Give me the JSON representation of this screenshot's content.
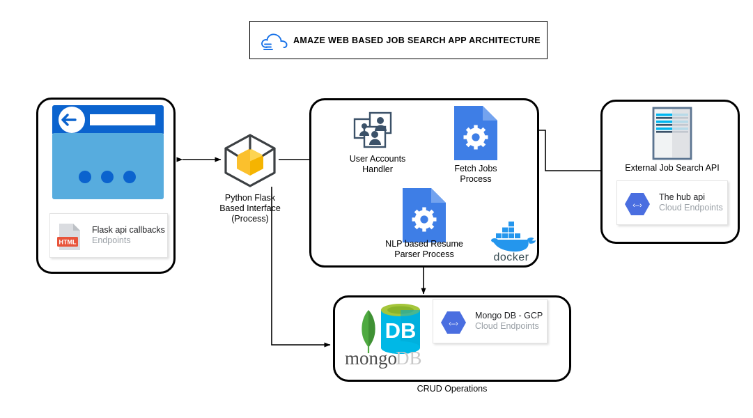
{
  "diagram": {
    "title": "AMAZE WEB BASED JOB SEARCH APP ARCHITECTURE",
    "title_icon": "cloud-icon",
    "background": "#ffffff",
    "stroke": "#000000"
  },
  "header": {
    "label": "AMAZE WEB BASED JOB SEARCH APP ARCHITECTURE",
    "icon_name": "cloud-icon",
    "icon_color": "#1a73e8"
  },
  "client_panel": {
    "name": "client-panel",
    "browser_icon": "browser-window-icon",
    "browser_header_color": "#0b63ce",
    "browser_body_color": "#57acde",
    "card": {
      "icon_name": "html-file-icon",
      "icon_label": "HTML",
      "title": "Flask api callbacks",
      "subtitle": "Endpoints"
    }
  },
  "gateway": {
    "name": "python-flask-interface",
    "icon_name": "cube-icon",
    "cube_color": "#fbc02d",
    "caption": "Python Flask\nBased Interface\n(Process)"
  },
  "server_panel": {
    "name": "server-panel",
    "nodes": [
      {
        "name": "user-accounts-handler",
        "icon_name": "users-photos-icon",
        "caption": "User Accounts\nHandler"
      },
      {
        "name": "fetch-jobs-process",
        "icon_name": "gear-document-icon",
        "caption": "Fetch Jobs\nProcess"
      },
      {
        "name": "nlp-resume-parser-process",
        "icon_name": "gear-document-icon",
        "caption": "NLP based Resume\nParser Process"
      }
    ],
    "docker": {
      "name": "docker-logo",
      "label": "docker",
      "color": "#2496ed"
    }
  },
  "external_panel": {
    "name": "external-job-search-api-panel",
    "icon_name": "api-server-icon",
    "caption": "External Job Search API",
    "card": {
      "icon_name": "cloud-endpoints-hexagon-icon",
      "icon_color": "#4a6ee0",
      "icon_glyph": "‹→›",
      "title": "The hub api",
      "subtitle": "Cloud Endpoints"
    }
  },
  "database_panel": {
    "name": "database-panel",
    "logo": {
      "name": "mongodb-logo",
      "text_mongo": "mongo",
      "text_db": "DB",
      "leaf_color": "#4faa41",
      "cylinder_color": "#13aa52"
    },
    "card": {
      "icon_name": "cloud-endpoints-hexagon-icon",
      "icon_color": "#4a6ee0",
      "icon_glyph": "‹→›",
      "title": "Mongo DB - GCP",
      "subtitle": "Cloud Endpoints"
    },
    "caption": "CRUD Operations"
  },
  "connectors": [
    {
      "name": "client-to-gateway",
      "from": "client-panel",
      "to": "python-flask-interface",
      "type": "bidirectional"
    },
    {
      "name": "gateway-to-user-accounts",
      "from": "python-flask-interface",
      "to": "user-accounts-handler",
      "type": "directed"
    },
    {
      "name": "gateway-to-nlp-parser",
      "from": "python-flask-interface",
      "to": "nlp-resume-parser-process",
      "type": "directed"
    },
    {
      "name": "gateway-to-database",
      "from": "python-flask-interface",
      "to": "database-panel",
      "type": "directed"
    },
    {
      "name": "external-api-to-fetch-jobs",
      "from": "external-job-search-api-panel",
      "to": "fetch-jobs-process",
      "type": "directed"
    },
    {
      "name": "server-to-database",
      "from": "server-panel",
      "to": "database-panel",
      "type": "directed"
    }
  ]
}
